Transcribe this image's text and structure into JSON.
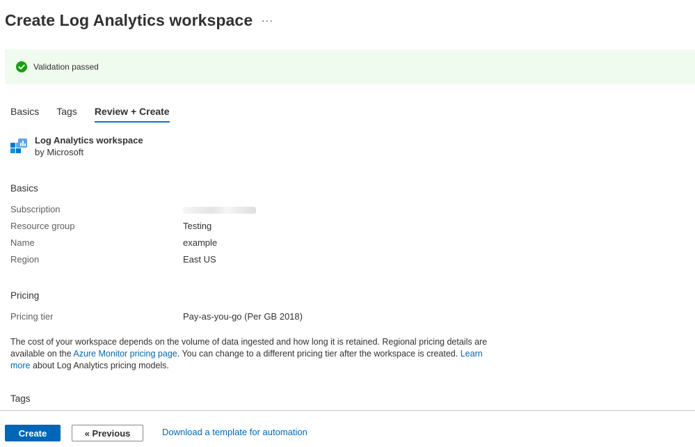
{
  "header": {
    "title": "Create Log Analytics workspace",
    "more_label": "···"
  },
  "banner": {
    "icon": "check-circle-icon",
    "status_color": "#13a10e",
    "text": "Validation passed"
  },
  "tabs": [
    {
      "label": "Basics",
      "active": false
    },
    {
      "label": "Tags",
      "active": false
    },
    {
      "label": "Review + Create",
      "active": true
    }
  ],
  "product": {
    "icon": "log-analytics-icon",
    "name": "Log Analytics workspace",
    "publisher": "by Microsoft"
  },
  "basics": {
    "heading": "Basics",
    "rows": [
      {
        "label": "Subscription",
        "value": ""
      },
      {
        "label": "Resource group",
        "value": "Testing"
      },
      {
        "label": "Name",
        "value": "example"
      },
      {
        "label": "Region",
        "value": "East US"
      }
    ]
  },
  "pricing": {
    "heading": "Pricing",
    "tier_label": "Pricing tier",
    "tier_value": "Pay-as-you-go (Per GB 2018)",
    "desc_part1": "The cost of your workspace depends on the volume of data ingested and how long it is retained. Regional pricing details are available on the ",
    "desc_link1": "Azure Monitor pricing page",
    "desc_part2": ". You can change to a different pricing tier after the workspace is created. ",
    "desc_link2": "Learn more",
    "desc_part3": " about Log Analytics pricing models."
  },
  "tags": {
    "heading": "Tags"
  },
  "footer": {
    "create_label": "Create",
    "previous_label": "« Previous",
    "download_label": "Download a template for automation"
  },
  "colors": {
    "accent": "#0067b8",
    "banner_bg": "#f0fbef"
  }
}
